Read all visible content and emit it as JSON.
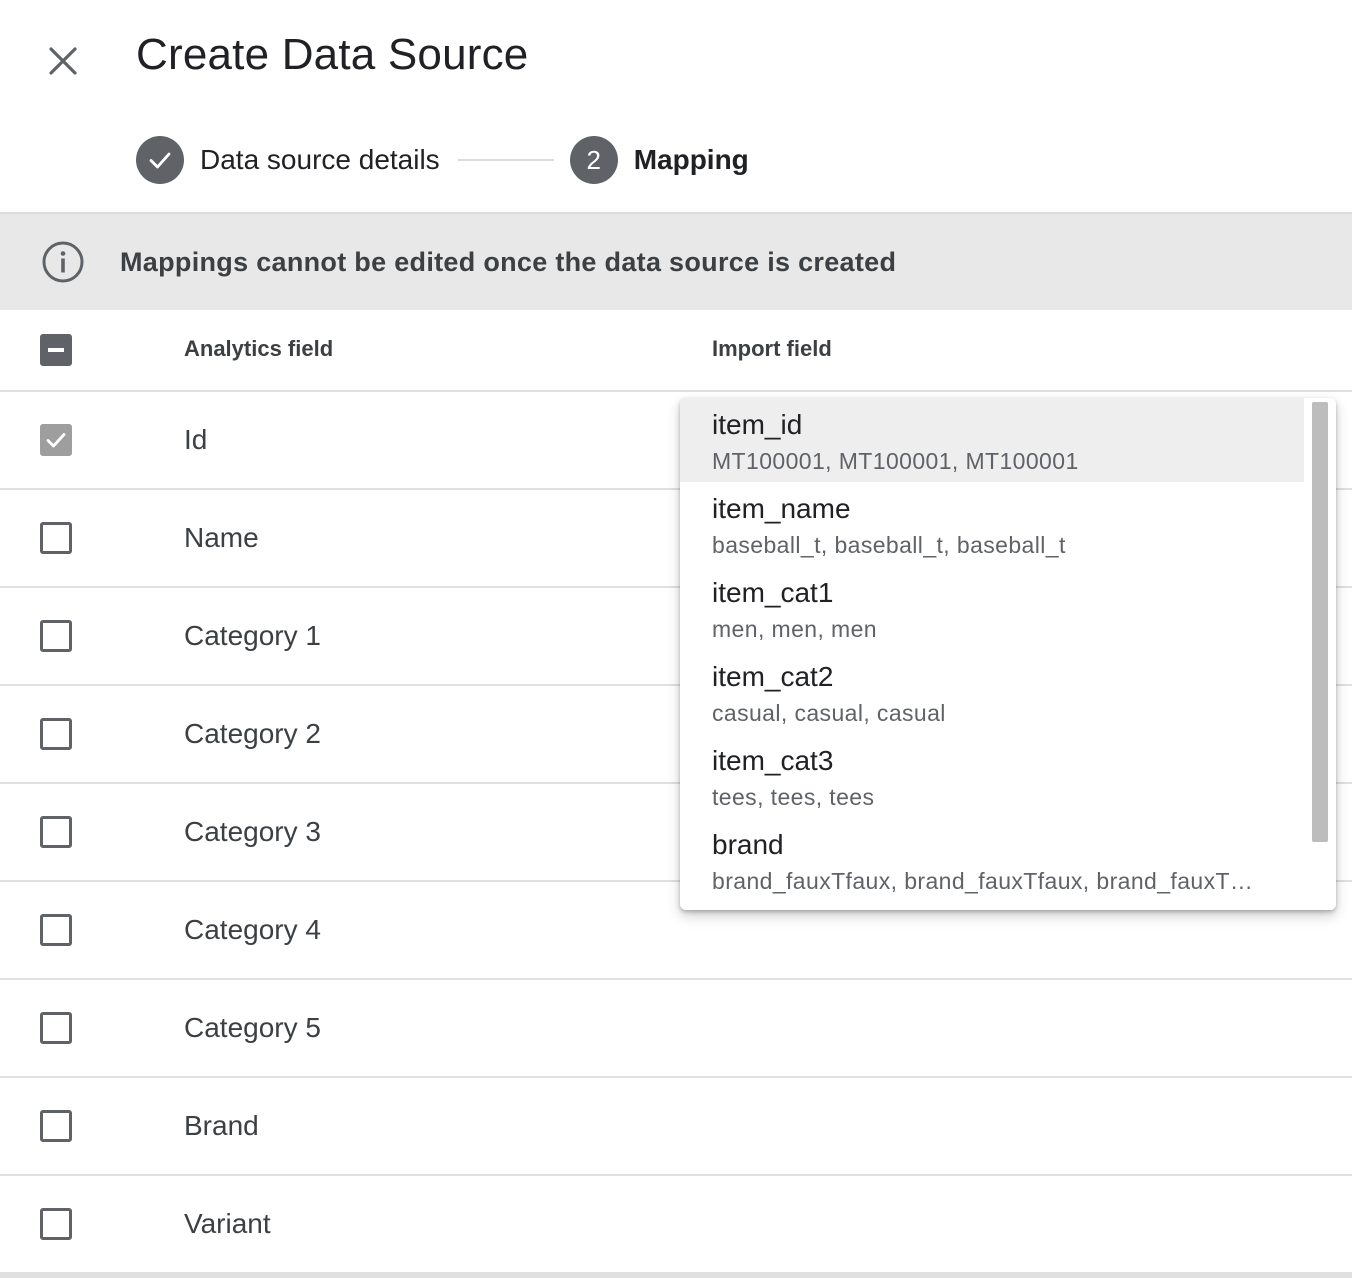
{
  "header": {
    "title": "Create Data Source",
    "close_icon": "close-icon"
  },
  "stepper": {
    "steps": [
      {
        "label": "Data source details",
        "state": "completed",
        "icon": "check-icon"
      },
      {
        "label": "Mapping",
        "state": "active",
        "number": "2"
      }
    ]
  },
  "banner": {
    "icon": "info-icon",
    "text": "Mappings cannot be edited once the data source is created"
  },
  "table": {
    "header": {
      "select_all_state": "indeterminate",
      "analytics_field": "Analytics field",
      "import_field": "Import field"
    },
    "rows": [
      {
        "label": "Id",
        "checked": true,
        "disabled": true
      },
      {
        "label": "Name",
        "checked": false
      },
      {
        "label": "Category 1",
        "checked": false
      },
      {
        "label": "Category 2",
        "checked": false
      },
      {
        "label": "Category 3",
        "checked": false
      },
      {
        "label": "Category 4",
        "checked": false
      },
      {
        "label": "Category 5",
        "checked": false
      },
      {
        "label": "Brand",
        "checked": false
      },
      {
        "label": "Variant",
        "checked": false
      }
    ]
  },
  "dropdown": {
    "selected_index": 0,
    "options": [
      {
        "name": "item_id",
        "sample": "MT100001, MT100001, MT100001"
      },
      {
        "name": "item_name",
        "sample": "baseball_t, baseball_t, baseball_t"
      },
      {
        "name": "item_cat1",
        "sample": "men, men, men"
      },
      {
        "name": "item_cat2",
        "sample": "casual, casual, casual"
      },
      {
        "name": "item_cat3",
        "sample": "tees, tees, tees"
      },
      {
        "name": "brand",
        "sample": "brand_fauxTfaux, brand_fauxTfaux, brand_fauxT…"
      }
    ]
  },
  "colors": {
    "step_circle": "#5f6368",
    "banner_bg": "#e8e8e8",
    "selected_option_bg": "#eeeeee",
    "scroll_thumb": "#bdbdbd"
  }
}
